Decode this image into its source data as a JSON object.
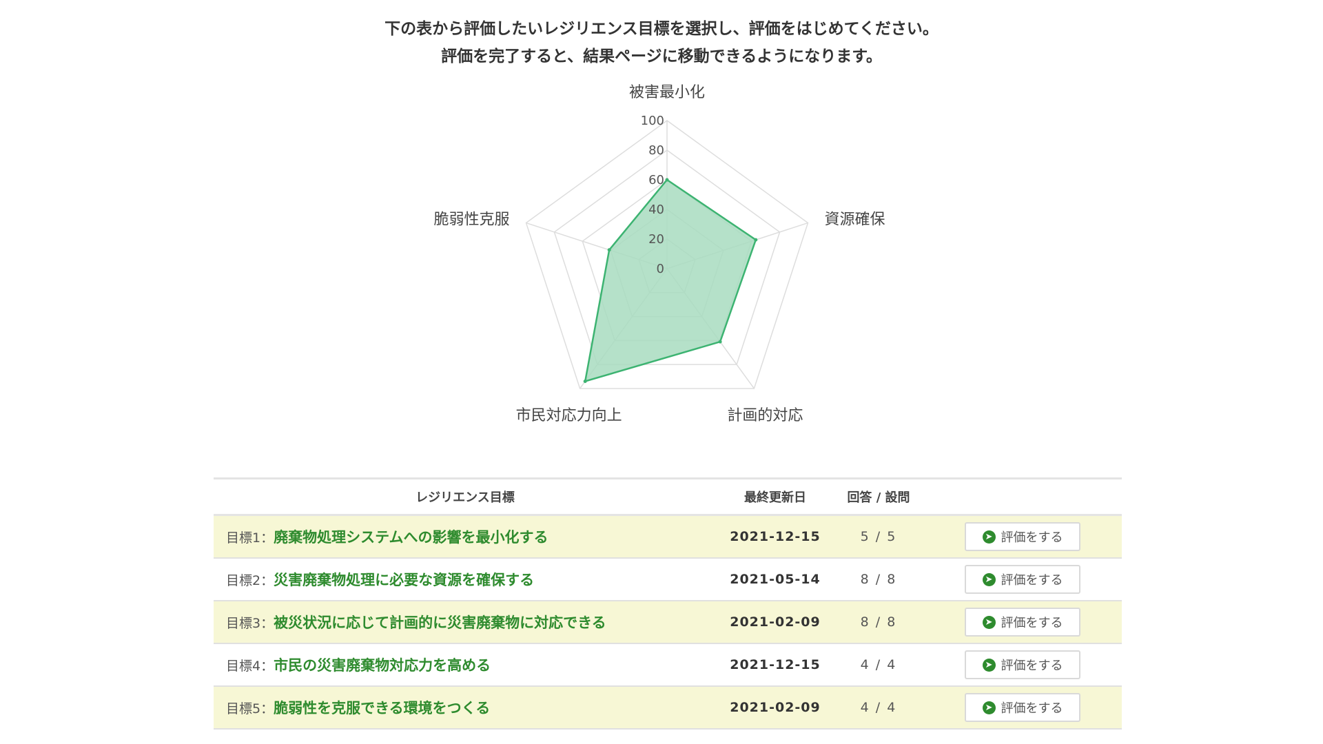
{
  "intro": {
    "line1": "下の表から評価したいレジリエンス目標を選択し、評価をはじめてください。",
    "line2": "評価を完了すると、結果ページに移動できるようになります。"
  },
  "chart_data": {
    "type": "radar",
    "axes": [
      "被害最小化",
      "資源確保",
      "計画的対応",
      "市民対応力向上",
      "脆弱性克服"
    ],
    "values": [
      60,
      63,
      61,
      94,
      41
    ],
    "ticks": [
      "0",
      "20",
      "40",
      "60",
      "80",
      "100"
    ],
    "range": [
      0,
      100
    ],
    "fill_color": "#a8dcc0",
    "line_color": "#3cb371",
    "grid": true
  },
  "table": {
    "headers": {
      "goal": "レジリエンス目標",
      "date": "最終更新日",
      "answers": "回答 / 設問"
    },
    "rows": [
      {
        "prefix": "目標1：",
        "title": "廃棄物処理システムへの影響を最小化する",
        "date": "2021-12-15",
        "answers": "5 / 5",
        "button": "評価をする"
      },
      {
        "prefix": "目標2：",
        "title": "災害廃棄物処理に必要な資源を確保する",
        "date": "2021-05-14",
        "answers": "8 / 8",
        "button": "評価をする"
      },
      {
        "prefix": "目標3：",
        "title": "被災状況に応じて計画的に災害廃棄物に対応できる",
        "date": "2021-02-09",
        "answers": "8 / 8",
        "button": "評価をする"
      },
      {
        "prefix": "目標4：",
        "title": "市民の災害廃棄物対応力を高める",
        "date": "2021-12-15",
        "answers": "4 / 4",
        "button": "評価をする"
      },
      {
        "prefix": "目標5：",
        "title": "脆弱性を克服できる環境をつくる",
        "date": "2021-02-09",
        "answers": "4 / 4",
        "button": "評価をする"
      }
    ]
  },
  "icons": {
    "button_icon": "arrow-circle-right-icon"
  },
  "colors": {
    "goal_title": "#2e8b2e",
    "row_highlight": "#f7f7d5"
  }
}
